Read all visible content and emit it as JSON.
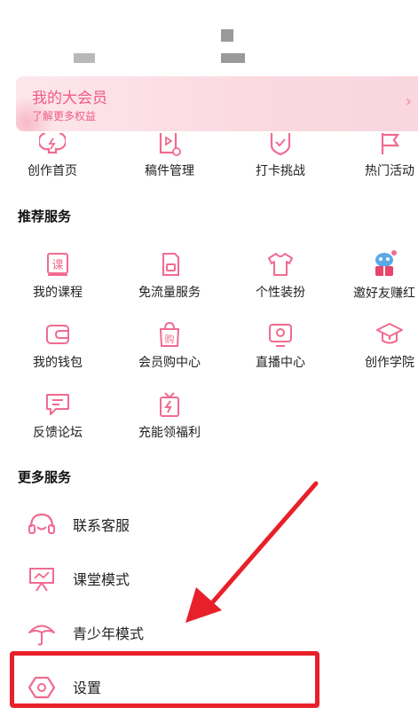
{
  "vip": {
    "title": "我的大会员",
    "subtitle": "了解更多权益",
    "arrow": "›"
  },
  "top_grid": [
    "创作首页",
    "稿件管理",
    "打卡挑战",
    "热门活动"
  ],
  "recommend": {
    "title": "推荐服务",
    "items": [
      "我的课程",
      "免流量服务",
      "个性装扮",
      "邀好友赚红",
      "我的钱包",
      "会员购中心",
      "直播中心",
      "创作学院",
      "反馈论坛",
      "充能领福利"
    ],
    "course_glyph": "课",
    "shop_glyph": "购"
  },
  "more": {
    "title": "更多服务",
    "items": [
      "联系客服",
      "课堂模式",
      "青少年模式",
      "设置"
    ]
  },
  "colors": {
    "accent": "#f06b91",
    "highlight": "#e8202a"
  }
}
